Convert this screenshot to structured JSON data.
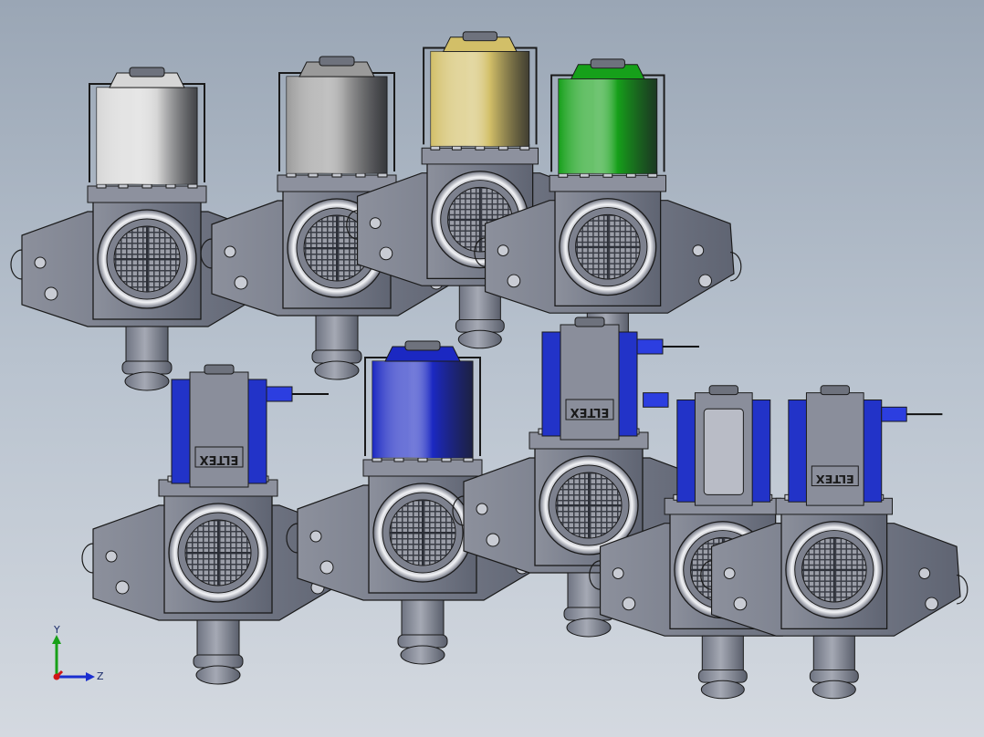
{
  "window": {
    "title": ""
  },
  "model": {
    "brand_marking": "ELTEX",
    "valves": [
      {
        "id": "v1",
        "coil_color": "#d6d6d6",
        "coil_type": "cylinder"
      },
      {
        "id": "v2",
        "coil_color": "#9a9a9a",
        "coil_type": "cylinder"
      },
      {
        "id": "v3",
        "coil_color": "#d2bf68",
        "coil_type": "cylinder"
      },
      {
        "id": "v4",
        "coil_color": "#16a01a",
        "coil_type": "cylinder"
      },
      {
        "id": "v5",
        "coil_color": "#2233c8",
        "coil_type": "eltex-box"
      },
      {
        "id": "v6",
        "coil_color": "#1b28c2",
        "coil_type": "cylinder"
      },
      {
        "id": "v7",
        "coil_color": "#2233c8",
        "coil_type": "eltex-box"
      },
      {
        "id": "v8",
        "coil_color": "#2233c8",
        "coil_type": "plain-box"
      },
      {
        "id": "v9",
        "coil_color": "#2233c8",
        "coil_type": "eltex-box"
      }
    ]
  },
  "triad": {
    "y_label": "Y",
    "z_label": "Z",
    "x_color": "#d01515",
    "y_color": "#18a018",
    "z_color": "#1a2ed0"
  },
  "colors": {
    "body": "#7a7f8e",
    "body_dark": "#5c6170",
    "outline": "#1a1a1a",
    "background_top": "#9aa6b5",
    "background_bottom": "#d4d9e0"
  }
}
